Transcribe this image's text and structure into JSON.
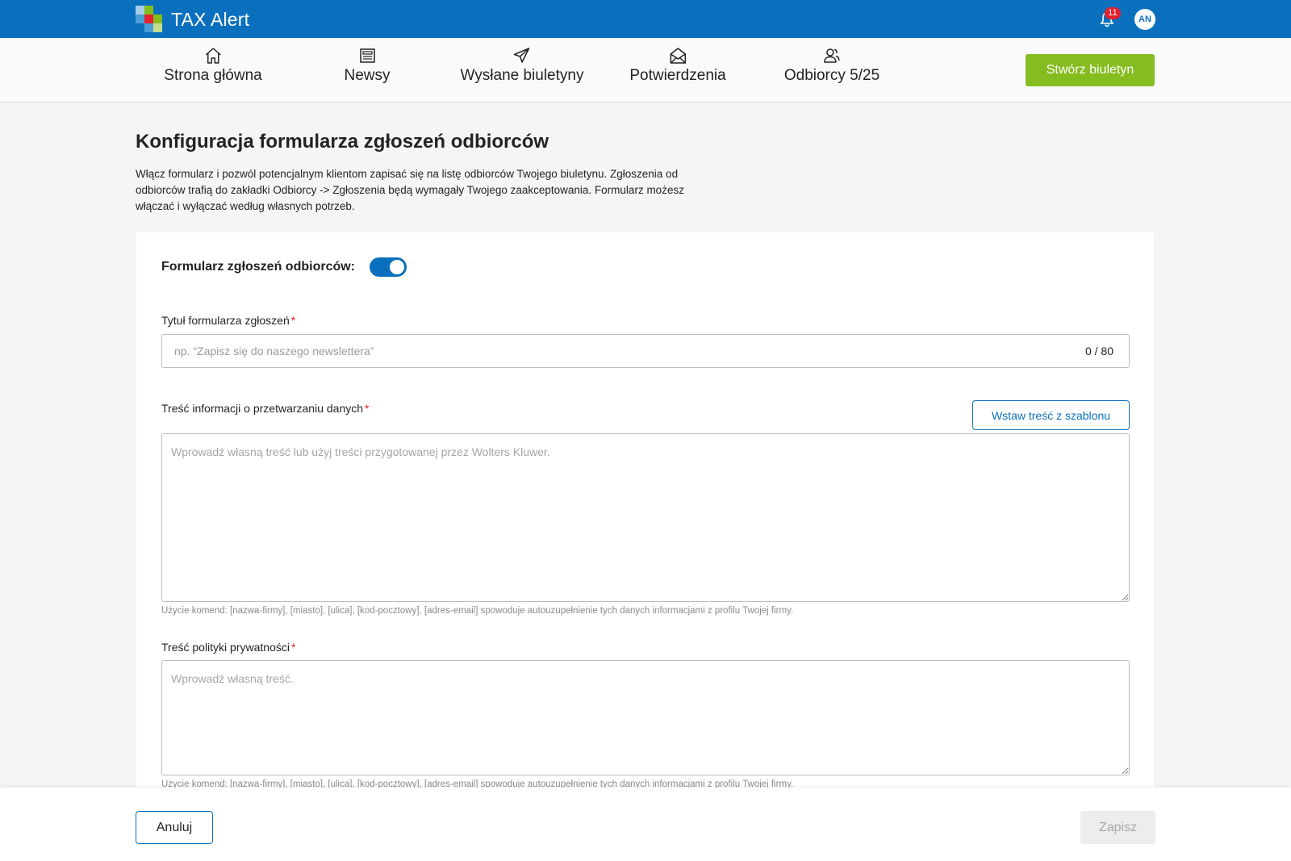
{
  "app": {
    "name": "TAX Alert",
    "notification_count": "11",
    "avatar_initials": "AN"
  },
  "nav": {
    "items": [
      {
        "label": "Strona główna",
        "icon": "home-icon"
      },
      {
        "label": "Newsy",
        "icon": "newspaper-icon"
      },
      {
        "label": "Wysłane biuletyny",
        "icon": "paper-plane-icon"
      },
      {
        "label": "Potwierdzenia",
        "icon": "envelope-open-icon"
      },
      {
        "label": "Odbiorcy 5/25",
        "icon": "users-icon"
      }
    ],
    "create_label": "Stwórz biuletyn"
  },
  "page": {
    "title": "Konfiguracja formularza zgłoszeń odbiorców",
    "description": "Włącz formularz i pozwól potencjalnym klientom zapisać się na listę odbiorców Twojego biuletynu. Zgłoszenia od odbiorców trafią do zakładki Odbiorcy -> Zgłoszenia będą wymagały Twojego zaakceptowania. Formularz możesz włączać i wyłączać według własnych potrzeb."
  },
  "form": {
    "toggle_label": "Formularz zgłoszeń odbiorców:",
    "toggle_on": true,
    "title_field": {
      "label": "Tytuł formularza zgłoszeń",
      "required_mark": "*",
      "placeholder": "np. “Zapisz się do naszego newslettera”",
      "value": "",
      "counter": "0 / 80"
    },
    "data_processing_field": {
      "label": "Treść informacji o przetwarzaniu danych",
      "required_mark": "*",
      "template_button": "Wstaw treść z szablonu",
      "placeholder": "Wprowadź własną treść lub użyj treści przygotowanej przez Wolters Kluwer.",
      "value": "",
      "hint": "Użycie komend: [nazwa-firmy], [miasto], [ulica], [kod-pocztowy], [adres-email] spowoduje autouzupełnienie tych danych informacjami z profilu Twojej firmy."
    },
    "privacy_field": {
      "label": "Treść polityki prywatności",
      "required_mark": "*",
      "placeholder": "Wprowadź własną treść.",
      "value": "",
      "hint": "Użycie komend: [nazwa-firmy], [miasto], [ulica], [kod-pocztowy], [adres-email] spowoduje autouzupełnienie tych danych informacjami z profilu Twojej firmy."
    }
  },
  "footer": {
    "cancel_label": "Anuluj",
    "save_label": "Zapisz"
  },
  "colors": {
    "brand_blue": "#0a70be",
    "accent_green": "#85bc20",
    "required_red": "#e5202e"
  }
}
